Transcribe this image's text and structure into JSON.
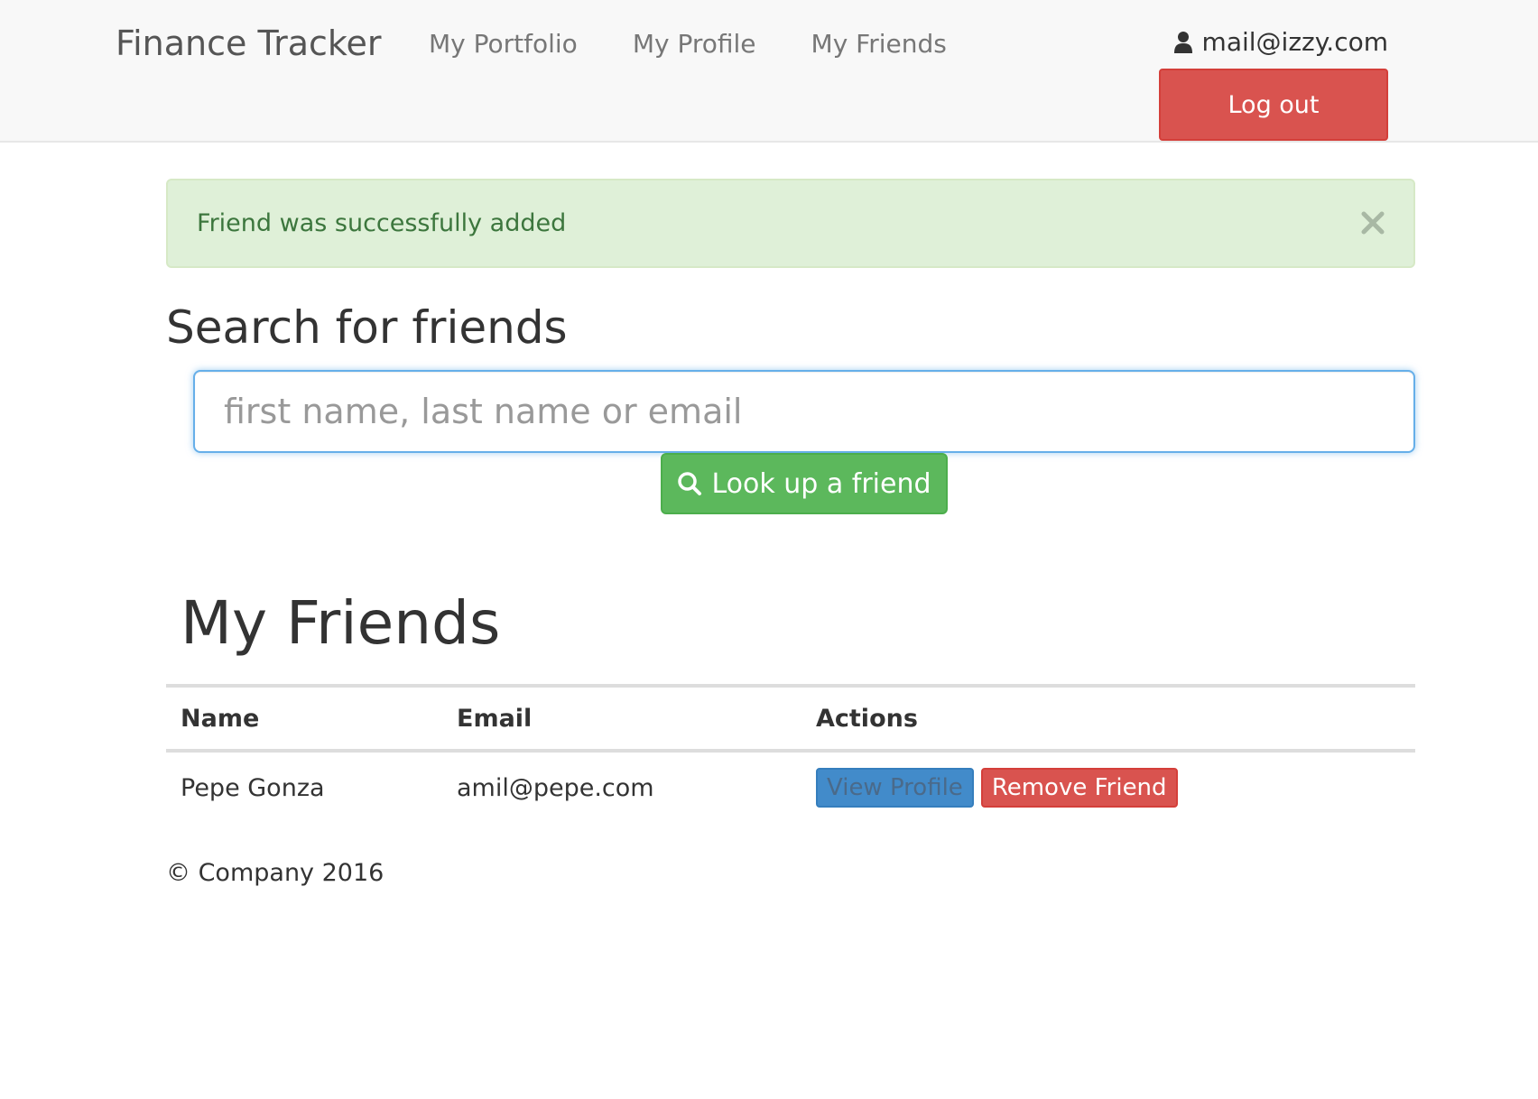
{
  "navbar": {
    "brand": "Finance Tracker",
    "links": [
      "My Portfolio",
      "My Profile",
      "My Friends"
    ],
    "user_email": "mail@izzy.com",
    "user_icon": "user-icon",
    "logout_label": "Log out"
  },
  "alert": {
    "message": "Friend was successfully added",
    "close_icon": "close-icon",
    "color": "#3c763d",
    "background": "#dff0d8"
  },
  "search": {
    "title": "Search for friends",
    "placeholder": "first name, last name or email",
    "value": "",
    "button_label": "Look up a friend",
    "button_icon": "search-icon"
  },
  "friends": {
    "title": "My Friends",
    "columns": [
      "Name",
      "Email",
      "Actions"
    ],
    "rows": [
      {
        "name": "Pepe Gonza",
        "email": "amil@pepe.com",
        "view_label": "View Profile",
        "remove_label": "Remove Friend"
      }
    ]
  },
  "footer": {
    "text": "© Company 2016"
  },
  "colors": {
    "danger": "#d9534f",
    "success": "#5cb85c",
    "primary": "#428bca",
    "focus": "#66afe9"
  }
}
